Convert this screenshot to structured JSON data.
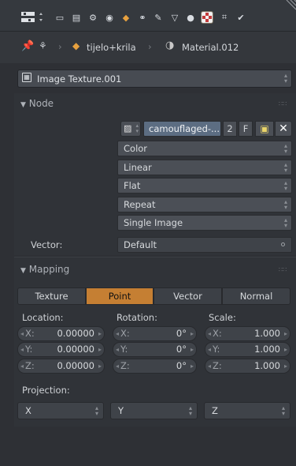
{
  "toolbar": {
    "icons": [
      "editor-type-icon",
      "render-icon",
      "render-layers-icon",
      "scene-icon",
      "world-icon",
      "object-icon",
      "constraints-icon",
      "modifiers-icon",
      "data-icon",
      "material-icon",
      "texture-icon",
      "particles-icon",
      "physics-icon"
    ]
  },
  "breadcrumb": {
    "object": "tijelo+krila",
    "material": "Material.012"
  },
  "node_selector": {
    "value": "Image Texture.001"
  },
  "node_panel": {
    "title": "Node",
    "image": {
      "name": "camouflaged-...",
      "users": "2",
      "fake_user": "F"
    },
    "settings": [
      "Color",
      "Linear",
      "Flat",
      "Repeat",
      "Single Image"
    ],
    "vector_label": "Vector:",
    "vector_value": "Default"
  },
  "mapping_panel": {
    "title": "Mapping",
    "tabs": [
      "Texture",
      "Point",
      "Vector",
      "Normal"
    ],
    "active_tab": "Point",
    "location": {
      "label": "Location:",
      "x": "0.00000",
      "y": "0.00000",
      "z": "0.00000"
    },
    "rotation": {
      "label": "Rotation:",
      "x": "0°",
      "y": "0°",
      "z": "0°"
    },
    "scale": {
      "label": "Scale:",
      "x": "1.000",
      "y": "1.000",
      "z": "1.000"
    },
    "axis_labels": {
      "x": "X:",
      "y": "Y:",
      "z": "Z:"
    },
    "projection_label": "Projection:",
    "projection": [
      "X",
      "Y",
      "Z"
    ]
  },
  "colors": {
    "accent": "#c57f33",
    "panel": "#303338",
    "field": "#4b4f56"
  }
}
